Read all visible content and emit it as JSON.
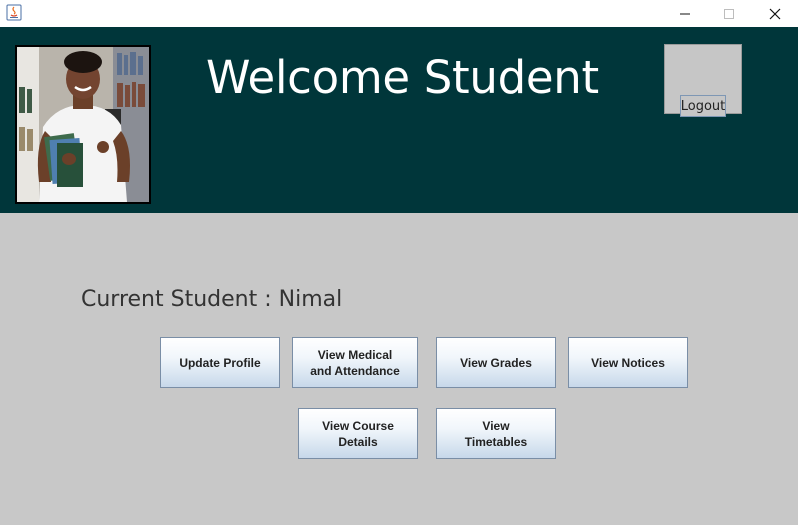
{
  "window": {
    "min_symbol": "—",
    "close_symbol": "✕",
    "icon": "java-icon"
  },
  "header": {
    "title": "Welcome Student",
    "logout_label": "Logout",
    "photo": "student-photo"
  },
  "main": {
    "current_student_label": "Current Student : Nimal",
    "buttons": {
      "update_profile": "Update Profile",
      "view_medical": "View Medical\nand Attendance",
      "view_grades": "View Grades",
      "view_notices": "View Notices",
      "view_course": "View Course\nDetails",
      "view_timetables": "View\nTimetables"
    }
  },
  "colors": {
    "header_bg": "#00363a",
    "content_bg": "#c8c8c8"
  }
}
